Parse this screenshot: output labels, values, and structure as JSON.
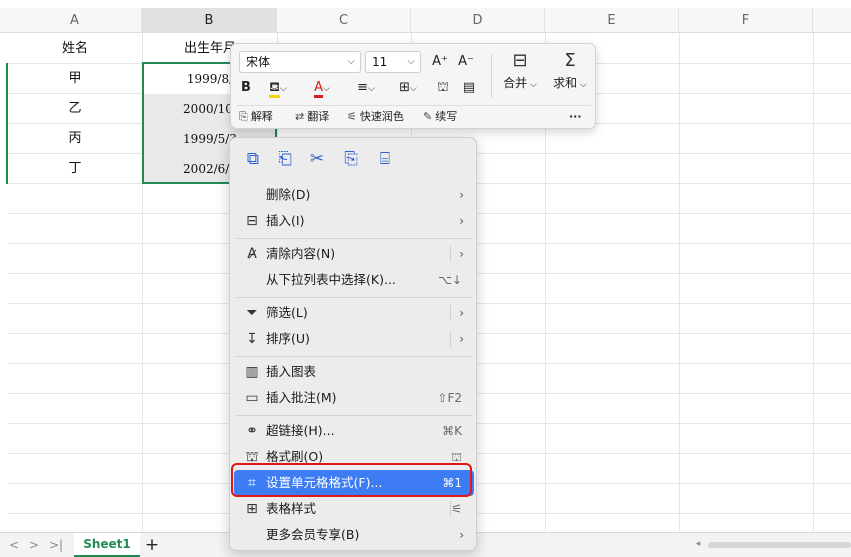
{
  "columns": [
    "A",
    "B",
    "C",
    "D",
    "E",
    "F"
  ],
  "rows": [
    {
      "name": "姓名",
      "birth": "出生年月"
    },
    {
      "name": "甲",
      "birth": "1999/8/"
    },
    {
      "name": "乙",
      "birth": "2000/10/"
    },
    {
      "name": "丙",
      "birth": "1999/5/3"
    },
    {
      "name": "丁",
      "birth": "2002/6/1"
    }
  ],
  "sheet_tab": "Sheet1",
  "bottom_nav": [
    "<",
    ">",
    ">|",
    "+"
  ],
  "toolbar": {
    "font_name": "宋体",
    "font_size": "11",
    "increase_font": "A⁺",
    "decrease_font": "A⁻",
    "bold": "B",
    "merge_label": "合并",
    "sum_label": "求和",
    "ai_explain": "解释",
    "ai_translate": "翻译",
    "ai_colorize": "快速润色",
    "ai_continue": "续写",
    "more": "···"
  },
  "context_menu": {
    "delete": {
      "label": "删除(D)"
    },
    "insert": {
      "label": "插入(I)"
    },
    "clear": {
      "label": "清除内容(N)"
    },
    "pick_from_list": {
      "label": "从下拉列表中选择(K)...",
      "shortcut": "⌥↓"
    },
    "filter": {
      "label": "筛选(L)"
    },
    "sort": {
      "label": "排序(U)"
    },
    "insert_chart": {
      "label": "插入图表"
    },
    "insert_comment": {
      "label": "插入批注(M)",
      "shortcut": "⇧F2"
    },
    "hyperlink": {
      "label": "超链接(H)...",
      "shortcut": "⌘K"
    },
    "format_painter": {
      "label": "格式刷(O)"
    },
    "format_cells": {
      "label": "设置单元格格式(F)...",
      "shortcut": "⌘1"
    },
    "table_style": {
      "label": "表格样式"
    },
    "member_more": {
      "label": "更多会员专享(B)"
    }
  },
  "colors": {
    "accent_green": "#1f8c52",
    "highlight_blue": "#3d7cf2",
    "annotation_red": "#e01818"
  }
}
